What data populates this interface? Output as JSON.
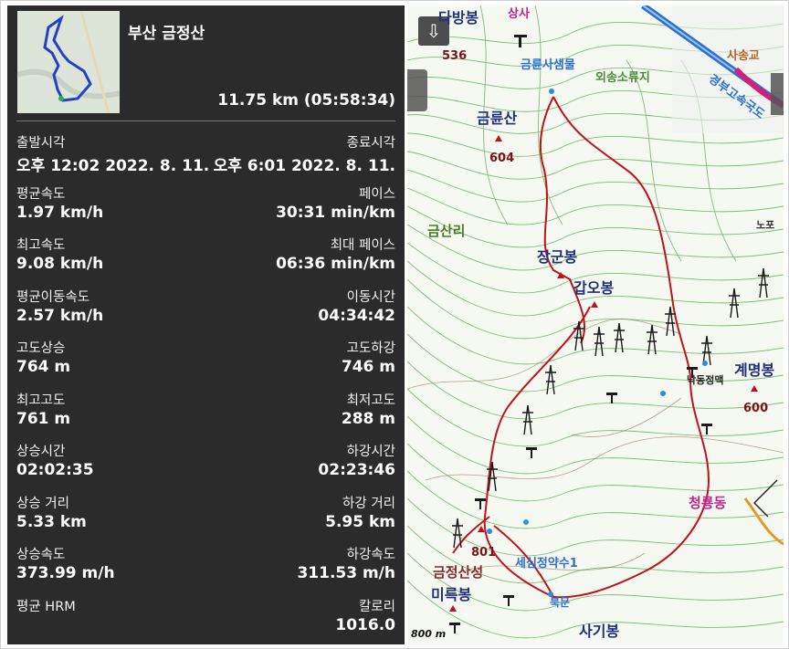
{
  "track": {
    "title": "부산 금정산",
    "summary": "11.75 km (05:58:34)"
  },
  "stats": [
    {
      "left_label": "출발시각",
      "left_value": "오후 12:02 2022. 8. 11.",
      "right_label": "종료시각",
      "right_value": "오후 6:01 2022. 8. 11."
    },
    {
      "left_label": "평균속도",
      "left_value": "1.97 km/h",
      "right_label": "페이스",
      "right_value": "30:31 min/km"
    },
    {
      "left_label": "최고속도",
      "left_value": "9.08 km/h",
      "right_label": "최대 페이스",
      "right_value": "06:36 min/km"
    },
    {
      "left_label": "평균이동속도",
      "left_value": "2.57 km/h",
      "right_label": "이동시간",
      "right_value": "04:34:42"
    },
    {
      "left_label": "고도상승",
      "left_value": "764 m",
      "right_label": "고도하강",
      "right_value": "746 m"
    },
    {
      "left_label": "최고고도",
      "left_value": "761 m",
      "right_label": "최저고도",
      "right_value": "288 m"
    },
    {
      "left_label": "상승시간",
      "left_value": "02:02:35",
      "right_label": "하강시간",
      "right_value": "02:23:46"
    },
    {
      "left_label": "상승 거리",
      "left_value": "5.33 km",
      "right_label": "하강 거리",
      "right_value": "5.95 km"
    },
    {
      "left_label": "상승속도",
      "left_value": "373.99 m/h",
      "right_label": "하강속도",
      "right_value": "311.53 m/h"
    },
    {
      "left_label": "평균 HRM",
      "left_value": "",
      "right_label": "칼로리",
      "right_value": "1016.0"
    }
  ],
  "map": {
    "labels": {
      "dabangbong": "다방봉",
      "sangsa": "상사",
      "elev_536": "536",
      "geumryunsa": "금륜사샘물",
      "oesong": "외송소류지",
      "geumryunsan": "금륜산",
      "elev_604": "604",
      "geumsanri": "금산리",
      "janggunbong": "장군봉",
      "gapobong": "갑오봉",
      "gyemyeongbong": "계명봉",
      "elev_600": "600",
      "cheongryongdong": "청룡동",
      "elev_801": "801",
      "sesimjeong": "세심정약수1",
      "geumjeongsanseong": "금정산성",
      "mireukbong": "미륵봉",
      "bukmun": "북문",
      "sagibong": "사기봉",
      "nakdong": "낙동정맥",
      "elev_800m": "800 m",
      "songgyo": "사송교",
      "expressway": "경부고속국도",
      "nopo": "노포"
    },
    "icons": [
      "layers-icon",
      "peak-marker-icon",
      "pylon-icon",
      "signpost-icon"
    ],
    "route_color": "#c0121b",
    "contour_color": "#55a651"
  }
}
